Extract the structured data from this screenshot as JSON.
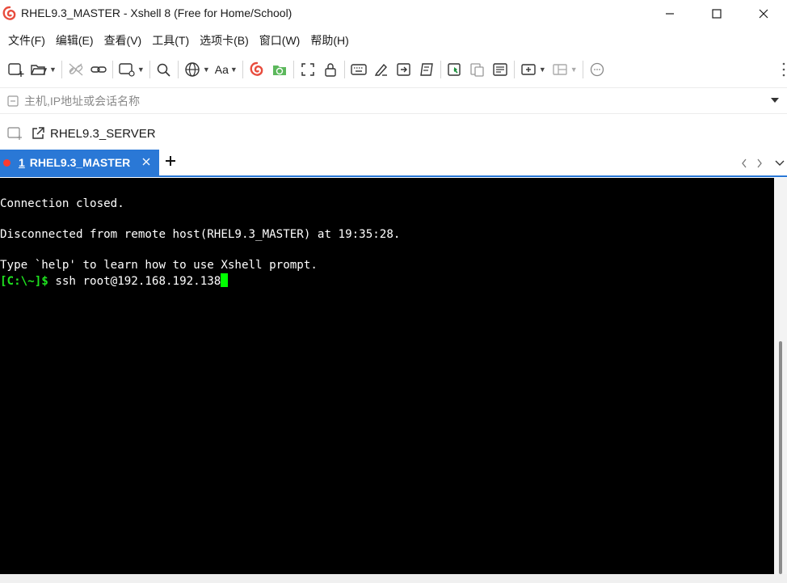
{
  "window": {
    "title": "RHEL9.3_MASTER - Xshell 8 (Free for Home/School)"
  },
  "menu": [
    "文件(F)",
    "编辑(E)",
    "查看(V)",
    "工具(T)",
    "选项卡(B)",
    "窗口(W)",
    "帮助(H)"
  ],
  "toolbar": {
    "font_label": "Aa",
    "icons": [
      "new-session-icon",
      "open-folder-icon",
      "disconnect-icon",
      "connect-link-icon",
      "new-tab-icon",
      "search-icon",
      "globe-icon",
      "font-icon",
      "xshell-logo-icon",
      "xftp-icon",
      "fullscreen-icon",
      "lock-icon",
      "keyboard-icon",
      "highlight-pen-icon",
      "send-icon",
      "script-icon",
      "compose-icon",
      "copy-icon",
      "paste-icon",
      "add-pane-icon",
      "layout-icon",
      "chat-icon"
    ]
  },
  "address": {
    "placeholder": "主机,IP地址或会话名称"
  },
  "links": {
    "session_label": "RHEL9.3_SERVER"
  },
  "tabs": [
    {
      "number": "1",
      "label": "RHEL9.3_MASTER",
      "status_color": "#ff3b30",
      "active": true
    }
  ],
  "terminal": {
    "lines": [
      "Connection closed.",
      "",
      "Disconnected from remote host(RHEL9.3_MASTER) at 19:35:28.",
      "",
      "Type `help' to learn how to use Xshell prompt."
    ],
    "prompt": "[C:\\~]$",
    "command": " ssh root@192.168.192.138"
  },
  "colors": {
    "accent": "#2a78d6",
    "terminal_bg": "#000000",
    "terminal_fg": "#ffffff",
    "prompt": "#1fe31f",
    "cursor": "#00ff00"
  }
}
